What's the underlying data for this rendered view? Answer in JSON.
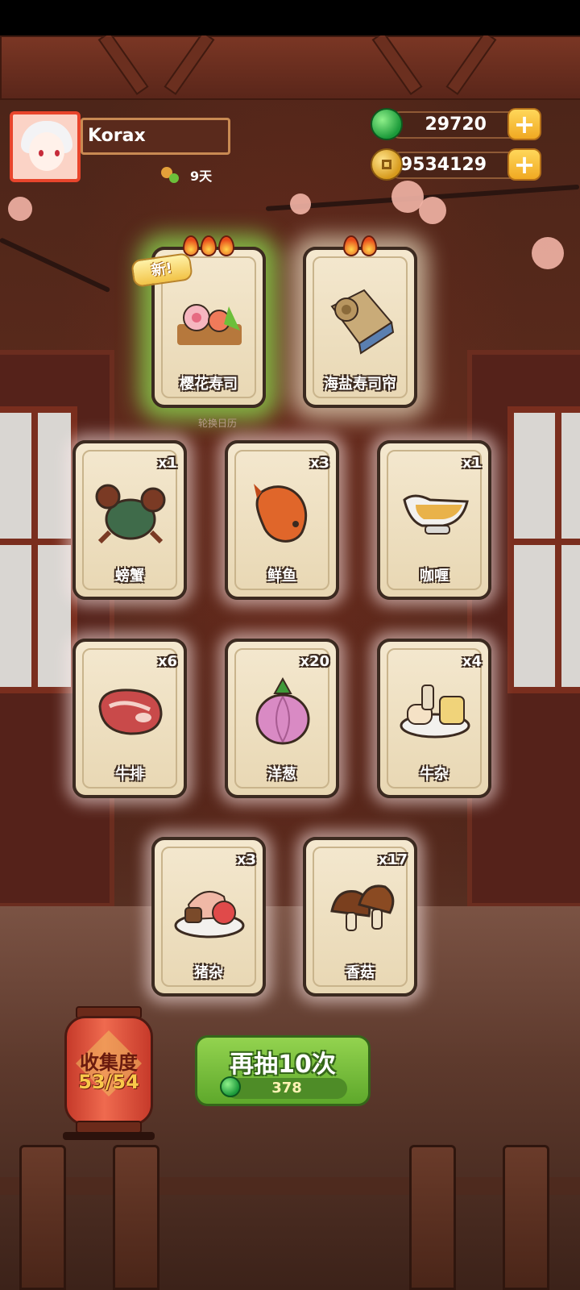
{
  "player": {
    "name": "Korax",
    "days": "9天"
  },
  "currency": {
    "gems": "29720",
    "coins": "9534129",
    "add_label": "+"
  },
  "featured": [
    {
      "name": "樱花寿司",
      "flames": 3,
      "badge": "新!"
    },
    {
      "name": "海盐寿司帘",
      "flames": 2
    }
  ],
  "calendar_label": "轮换日历",
  "items": [
    {
      "name": "螃蟹",
      "qty": "x1"
    },
    {
      "name": "鲜鱼",
      "qty": "x3"
    },
    {
      "name": "咖喱",
      "qty": "x1"
    },
    {
      "name": "牛排",
      "qty": "x6"
    },
    {
      "name": "洋葱",
      "qty": "x20"
    },
    {
      "name": "牛杂",
      "qty": "x4"
    },
    {
      "name": "猪杂",
      "qty": "x3"
    },
    {
      "name": "香菇",
      "qty": "x17"
    }
  ],
  "collection": {
    "label": "收集度",
    "progress": "53/54"
  },
  "draw": {
    "label": "再抽10次",
    "cost": "378"
  },
  "colors": {
    "accent_green": "#5ea82b",
    "gold": "#f0a922",
    "lantern_red": "#c63a2a"
  }
}
